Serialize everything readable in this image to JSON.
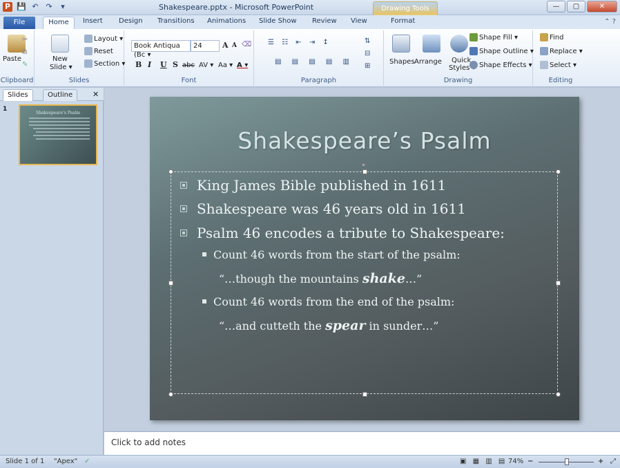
{
  "window": {
    "title": "Shakespeare.pptx - Microsoft PowerPoint",
    "context_tools": "Drawing Tools"
  },
  "quick_access": {
    "logo": "P",
    "save": "💾",
    "undo": "↶",
    "redo": "↷",
    "customize": "▾"
  },
  "window_buttons": {
    "minimize": "—",
    "maximize": "▢",
    "close": "✕"
  },
  "tabs": [
    "File",
    "Home",
    "Insert",
    "Design",
    "Transitions",
    "Animations",
    "Slide Show",
    "Review",
    "View",
    "Format"
  ],
  "help": "⌃ ?",
  "ribbon": {
    "clipboard": {
      "label": "Clipboard",
      "paste": "Paste"
    },
    "slides": {
      "label": "Slides",
      "new_slide": "New",
      "new_slide_2": "Slide ▾",
      "layout": "Layout ▾",
      "reset": "Reset",
      "section": "Section ▾"
    },
    "font": {
      "label": "Font",
      "font_name": "Book Antiqua (Bc ▾",
      "font_size": "24",
      "grow": "A",
      "shrink": "A",
      "clear": "⌫",
      "bold": "B",
      "italic": "I",
      "underline": "U",
      "strike": "abc",
      "shadow": "S",
      "spacing": "AV ▾",
      "case": "Aa ▾",
      "color": "A ▾"
    },
    "paragraph": {
      "label": "Paragraph"
    },
    "drawing": {
      "label": "Drawing",
      "shapes": "Shapes",
      "arrange": "Arrange",
      "quick_styles": "Quick",
      "quick_styles_2": "Styles ▾",
      "shape_fill": "Shape Fill ▾",
      "shape_outline": "Shape Outline ▾",
      "shape_effects": "Shape Effects ▾"
    },
    "editing": {
      "label": "Editing",
      "find": "Find",
      "replace": "Replace ▾",
      "select": "Select ▾"
    }
  },
  "left_pane": {
    "tab_slides": "Slides",
    "tab_outline": "Outline",
    "close": "✕",
    "slide_number": "1",
    "thumb_title": "Shakespeare's Psalm"
  },
  "slide": {
    "title": "Shakespeare’s Psalm",
    "bullets": [
      "King James Bible published in 1611",
      "Shakespeare was 46 years old in 1611",
      "Psalm 46 encodes a tribute to Shakespeare:"
    ],
    "sub1": "Count 46 words from the start of the psalm:",
    "quote1_pre": "“…though the mountains ",
    "quote1_em": "shake",
    "quote1_post": "…”",
    "sub2": "Count 46 words from the end of the psalm:",
    "quote2_pre": "“…and cutteth the ",
    "quote2_em": "spear",
    "quote2_post": " in sunder…”"
  },
  "notes": {
    "placeholder": "Click to add notes"
  },
  "status": {
    "slide": "Slide 1 of 1",
    "theme": "\"Apex\"",
    "check": "✓",
    "zoom": "74%",
    "minus": "−",
    "plus": "+"
  }
}
